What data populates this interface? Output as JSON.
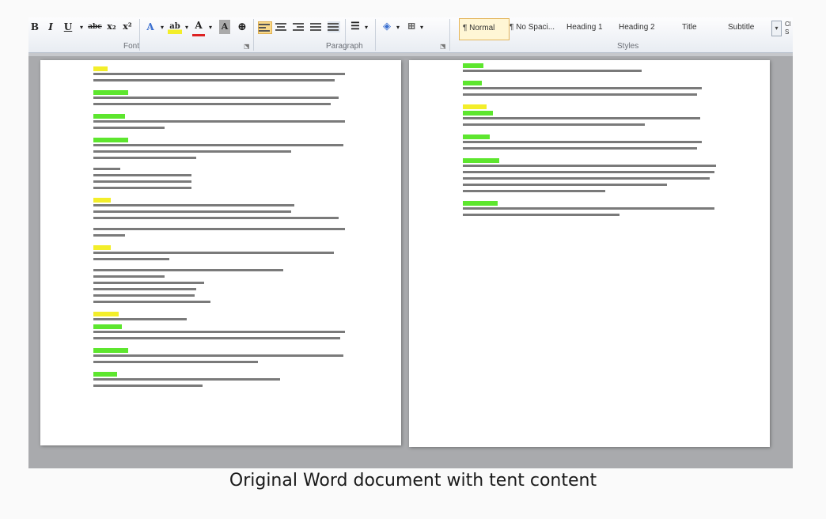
{
  "caption": "Original Word document with tent content",
  "ribbon": {
    "font_group_label": "Font",
    "paragraph_group_label": "Paragraph",
    "styles_group_label": "Styles",
    "font_buttons": [
      "B",
      "I",
      "U",
      "abc",
      "x₂",
      "x²",
      "A",
      "ab",
      "A",
      "A",
      "⊕"
    ],
    "styles": [
      "¶ Normal",
      "¶ No Spaci...",
      "Heading 1",
      "Heading 2",
      "Title",
      "Subtitle"
    ],
    "selected_style": "¶ Normal",
    "cut_off_label": "Cl S"
  },
  "colors": {
    "highlight_yellow": "#f3ee2a",
    "highlight_green": "#5de62e",
    "ribbon_bg": "#eef1f6",
    "workspace": "#a9aaad"
  },
  "icons": [
    "bold-icon",
    "italic-icon",
    "underline-icon",
    "strikethrough-icon",
    "subscript-icon",
    "superscript-icon",
    "text-effects-icon",
    "highlight-icon",
    "font-color-icon",
    "char-shading-icon",
    "enclose-char-icon",
    "align-left-icon",
    "center-icon",
    "align-right-icon",
    "justify-icon",
    "distributed-icon",
    "line-spacing-icon",
    "shading-icon",
    "borders-icon",
    "styles-scroll-icon",
    "dialog-launcher-icon"
  ]
}
